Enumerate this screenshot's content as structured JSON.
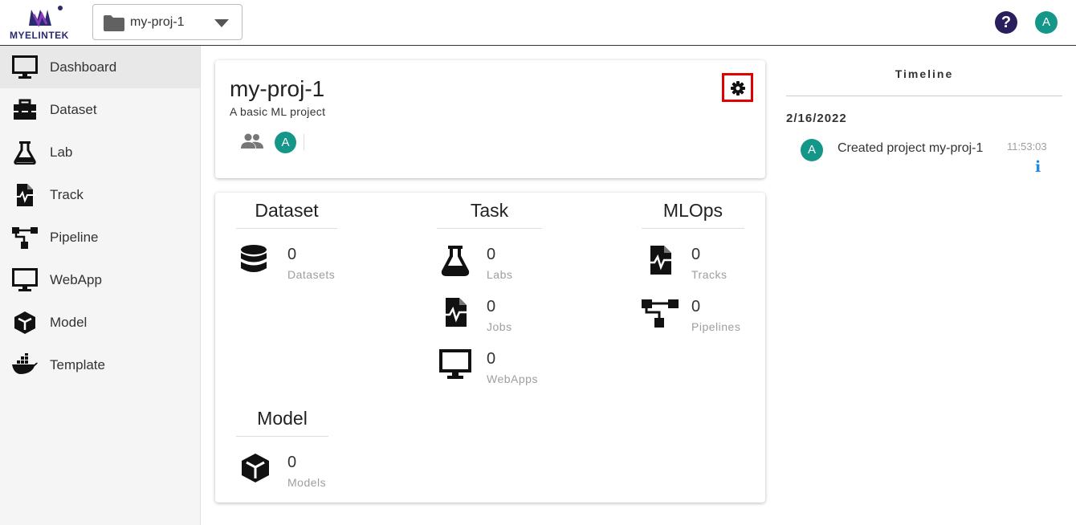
{
  "app": {
    "logo_text": "MYELINTEK",
    "project_selector_value": "my-proj-1",
    "user_initial": "A",
    "help_symbol": "?"
  },
  "sidebar": {
    "items": [
      {
        "label": "Dashboard",
        "icon": "monitor-icon",
        "active": true
      },
      {
        "label": "Dataset",
        "icon": "toolbox-icon"
      },
      {
        "label": "Lab",
        "icon": "flask-icon"
      },
      {
        "label": "Track",
        "icon": "file-waveform-icon"
      },
      {
        "label": "Pipeline",
        "icon": "sitemap-icon"
      },
      {
        "label": "WebApp",
        "icon": "monitor-icon"
      },
      {
        "label": "Model",
        "icon": "cube-icon"
      },
      {
        "label": "Template",
        "icon": "docker-whale-icon"
      }
    ]
  },
  "project": {
    "title": "my-proj-1",
    "description": "A basic ML project",
    "member_initial": "A"
  },
  "stats": {
    "dataset": {
      "title": "Dataset",
      "items": [
        {
          "value": "0",
          "label": "Datasets",
          "icon": "database-icon"
        }
      ]
    },
    "task": {
      "title": "Task",
      "items": [
        {
          "value": "0",
          "label": "Labs",
          "icon": "flask-icon"
        },
        {
          "value": "0",
          "label": "Jobs",
          "icon": "file-waveform-icon"
        },
        {
          "value": "0",
          "label": "WebApps",
          "icon": "monitor-icon"
        }
      ]
    },
    "mlops": {
      "title": "MLOps",
      "items": [
        {
          "value": "0",
          "label": "Tracks",
          "icon": "file-waveform-icon"
        },
        {
          "value": "0",
          "label": "Pipelines",
          "icon": "sitemap-icon"
        }
      ]
    },
    "model": {
      "title": "Model",
      "items": [
        {
          "value": "0",
          "label": "Models",
          "icon": "cube-icon"
        }
      ]
    }
  },
  "timeline": {
    "title": "Timeline",
    "date": "2/16/2022",
    "entries": [
      {
        "initial": "A",
        "text": "Created project my-proj-1",
        "time": "11:53:03",
        "info": "i"
      }
    ]
  },
  "colors": {
    "accent_teal": "#149688",
    "help_navy": "#2a1f5c",
    "highlight_red": "#e00000",
    "info_blue": "#1e88e5"
  }
}
